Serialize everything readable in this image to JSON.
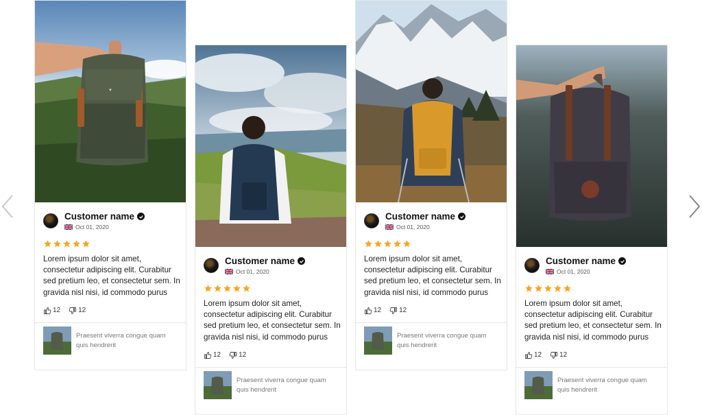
{
  "nav": {
    "prev_label": "‹",
    "next_label": "›"
  },
  "reviews": [
    {
      "photo": "hand-holding-green-backpack",
      "author": "Customer name",
      "date": "Oct 01, 2020",
      "country": "UK",
      "rating": 5,
      "text": "Lorem ipsum dolor sit amet, consectetur adipiscing elit. Curabitur sed pretium leo, et consectetur sem. In gravida nisl nisi, id commodo purus",
      "likes": "12",
      "dislikes": "12",
      "product": "Praesent viverra congue quam quis hendrerit"
    },
    {
      "photo": "person-sitting-mountain-view",
      "author": "Customer name",
      "date": "Oct 01, 2020",
      "country": "UK",
      "rating": 5,
      "text": "Lorem ipsum dolor sit amet, consectetur adipiscing elit. Curabitur sed pretium leo, et consectetur sem. In gravida nisl nisi, id commodo purus",
      "likes": "12",
      "dislikes": "12",
      "product": "Praesent viverra congue quam quis hendrerit"
    },
    {
      "photo": "hiker-snowy-mountains",
      "author": "Customer name",
      "date": "Oct 01, 2020",
      "country": "UK",
      "rating": 5,
      "text": "Lorem ipsum dolor sit amet, consectetur adipiscing elit. Curabitur sed pretium leo, et consectetur sem. In gravida nisl nisi, id commodo purus",
      "likes": "12",
      "dislikes": "12",
      "product": "Praesent viverra congue quam quis hendrerit"
    },
    {
      "photo": "hand-holding-dark-backpack",
      "author": "Customer name",
      "date": "Oct 01, 2020",
      "country": "UK",
      "rating": 5,
      "text": "Lorem ipsum dolor sit amet, consectetur adipiscing elit. Curabitur sed pretium leo, et consectetur sem. In gravida nisl nisi, id commodo purus",
      "likes": "12",
      "dislikes": "12",
      "product": "Praesent viverra congue quam quis hendrerit"
    }
  ],
  "colors": {
    "star": "#f5a623",
    "border": "#e6e6e6",
    "muted": "#777777"
  }
}
